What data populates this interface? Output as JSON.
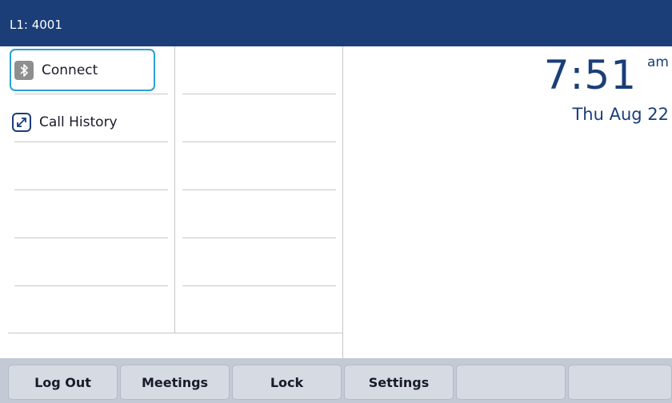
{
  "header": {
    "line_label": "L1: 4001"
  },
  "line_keys": [
    {
      "label": "Connect",
      "icon": "bluetooth-icon",
      "focused": true
    },
    {
      "label": "Call History",
      "icon": "call-history-icon",
      "focused": false
    }
  ],
  "clock": {
    "time": "7:51",
    "ampm": "am",
    "date": "Thu Aug 22"
  },
  "softkeys": [
    {
      "label": "Log Out"
    },
    {
      "label": "Meetings"
    },
    {
      "label": "Lock"
    },
    {
      "label": "Settings"
    },
    {
      "label": ""
    },
    {
      "label": ""
    }
  ],
  "colors": {
    "header_bg": "#1b3e78",
    "focus_ring": "#2a9fd6",
    "softkey_bar_bg": "#c4c9d6",
    "softkey_bg": "#d6dae3",
    "clock_text": "#1b3e78"
  }
}
